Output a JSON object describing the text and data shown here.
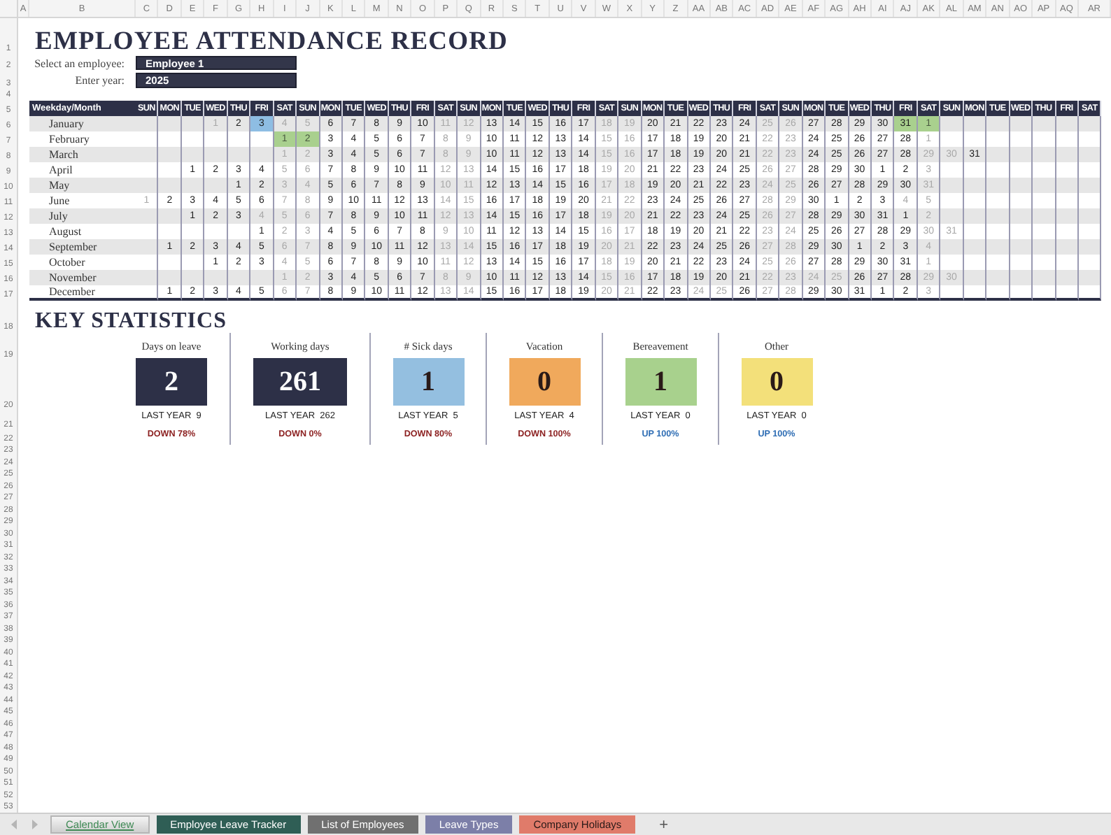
{
  "column_headers": [
    "A",
    "B",
    "C",
    "D",
    "E",
    "F",
    "G",
    "H",
    "I",
    "J",
    "K",
    "L",
    "M",
    "N",
    "O",
    "P",
    "Q",
    "R",
    "S",
    "T",
    "U",
    "V",
    "W",
    "X",
    "Y",
    "Z",
    "AA",
    "AB",
    "AC",
    "AD",
    "AE",
    "AF",
    "AG",
    "AH",
    "AI",
    "AJ",
    "AK",
    "AL",
    "AM",
    "AN",
    "AO",
    "AP",
    "AQ",
    "AR"
  ],
  "row_numbers": [
    "1",
    "2",
    "3",
    "4",
    "5",
    "6",
    "7",
    "8",
    "9",
    "10",
    "11",
    "12",
    "13",
    "14",
    "15",
    "16",
    "17",
    "18",
    "19",
    "20",
    "21",
    "22",
    "23",
    "24",
    "25",
    "26",
    "27",
    "28",
    "29",
    "30",
    "31",
    "32",
    "33",
    "34",
    "35",
    "36",
    "37",
    "38",
    "39",
    "40",
    "41",
    "42",
    "43",
    "44",
    "45",
    "46",
    "47",
    "48",
    "49",
    "50",
    "51",
    "52",
    "53"
  ],
  "title": "EMPLOYEE ATTENDANCE RECORD",
  "fields": [
    {
      "label": "Select an employee:",
      "value": "Employee 1"
    },
    {
      "label": "Enter year:",
      "value": "2025"
    }
  ],
  "calendar": {
    "corner": "Weekday/Month",
    "weekdays": [
      "SUN",
      "MON",
      "TUE",
      "WED",
      "THU",
      "FRI",
      "SAT",
      "SUN",
      "MON",
      "TUE",
      "WED",
      "THU",
      "FRI",
      "SAT",
      "SUN",
      "MON",
      "TUE",
      "WED",
      "THU",
      "FRI",
      "SAT",
      "SUN",
      "MON",
      "TUE",
      "WED",
      "THU",
      "FRI",
      "SAT",
      "SUN",
      "MON",
      "TUE",
      "WED",
      "THU",
      "FRI",
      "SAT",
      "SUN",
      "MON",
      "TUE",
      "WED",
      "THU",
      "FRI",
      "SAT"
    ],
    "rows": [
      {
        "month": "January",
        "days": [
          {
            "blank": true
          },
          {
            "blank": true
          },
          {
            "blank": true
          },
          {
            "day": "1",
            "dim": true
          },
          "2",
          {
            "day": "3",
            "color": "#8ebde3"
          },
          {
            "day": "4",
            "dim": true
          },
          {
            "day": "5",
            "dim": true
          },
          "6",
          "7",
          "8",
          "9",
          "10",
          {
            "day": "11",
            "dim": true
          },
          {
            "day": "12",
            "dim": true
          },
          "13",
          "14",
          "15",
          "16",
          "17",
          {
            "day": "18",
            "dim": true
          },
          {
            "day": "19",
            "dim": true
          },
          "20",
          "21",
          "22",
          "23",
          "24",
          {
            "day": "25",
            "dim": true
          },
          {
            "day": "26",
            "dim": true
          },
          "27",
          "28",
          "29",
          "30",
          {
            "day": "31",
            "color": "#a9d08e"
          },
          {
            "day": "1",
            "dim": true,
            "color": "#a9d08e"
          }
        ]
      },
      {
        "month": "February",
        "days": [
          {
            "blank": true
          },
          {
            "blank": true
          },
          {
            "blank": true
          },
          {
            "blank": true
          },
          {
            "blank": true
          },
          {
            "blank": true
          },
          {
            "day": "1",
            "dim": true,
            "color": "#a9d08e"
          },
          {
            "day": "2",
            "dim": true,
            "color": "#a9d08e"
          },
          "3",
          "4",
          "5",
          "6",
          "7",
          {
            "day": "8",
            "dim": true
          },
          {
            "day": "9",
            "dim": true
          },
          "10",
          "11",
          "12",
          "13",
          "14",
          {
            "day": "15",
            "dim": true
          },
          {
            "day": "16",
            "dim": true
          },
          "17",
          "18",
          "19",
          "20",
          "21",
          {
            "day": "22",
            "dim": true
          },
          {
            "day": "23",
            "dim": true
          },
          "24",
          "25",
          "26",
          "27",
          "28",
          {
            "day": "1",
            "dim": true
          }
        ]
      },
      {
        "month": "March",
        "days": [
          {
            "blank": true
          },
          {
            "blank": true
          },
          {
            "blank": true
          },
          {
            "blank": true
          },
          {
            "blank": true
          },
          {
            "blank": true
          },
          {
            "day": "1",
            "dim": true
          },
          {
            "day": "2",
            "dim": true
          },
          "3",
          "4",
          "5",
          "6",
          "7",
          {
            "day": "8",
            "dim": true
          },
          {
            "day": "9",
            "dim": true
          },
          "10",
          "11",
          "12",
          "13",
          "14",
          {
            "day": "15",
            "dim": true
          },
          {
            "day": "16",
            "dim": true
          },
          "17",
          "18",
          "19",
          "20",
          "21",
          {
            "day": "22",
            "dim": true
          },
          {
            "day": "23",
            "dim": true
          },
          "24",
          "25",
          "26",
          "27",
          "28",
          {
            "day": "29",
            "dim": true
          },
          {
            "day": "30",
            "dim": true
          },
          "31"
        ]
      },
      {
        "month": "April",
        "days": [
          {
            "blank": true
          },
          {
            "blank": true
          },
          "1",
          "2",
          "3",
          "4",
          {
            "day": "5",
            "dim": true
          },
          {
            "day": "6",
            "dim": true
          },
          "7",
          "8",
          "9",
          "10",
          "11",
          {
            "day": "12",
            "dim": true
          },
          {
            "day": "13",
            "dim": true
          },
          "14",
          "15",
          "16",
          "17",
          "18",
          {
            "day": "19",
            "dim": true
          },
          {
            "day": "20",
            "dim": true
          },
          "21",
          "22",
          "23",
          "24",
          "25",
          {
            "day": "26",
            "dim": true
          },
          {
            "day": "27",
            "dim": true
          },
          "28",
          "29",
          "30",
          "1",
          "2",
          {
            "day": "3",
            "dim": true
          }
        ]
      },
      {
        "month": "May",
        "days": [
          {
            "blank": true
          },
          {
            "blank": true
          },
          {
            "blank": true
          },
          {
            "blank": true
          },
          "1",
          "2",
          {
            "day": "3",
            "dim": true
          },
          {
            "day": "4",
            "dim": true
          },
          "5",
          "6",
          "7",
          "8",
          "9",
          {
            "day": "10",
            "dim": true
          },
          {
            "day": "11",
            "dim": true
          },
          "12",
          "13",
          "14",
          "15",
          "16",
          {
            "day": "17",
            "dim": true
          },
          {
            "day": "18",
            "dim": true
          },
          "19",
          "20",
          "21",
          "22",
          "23",
          {
            "day": "24",
            "dim": true
          },
          {
            "day": "25",
            "dim": true
          },
          "26",
          "27",
          "28",
          "29",
          "30",
          {
            "day": "31",
            "dim": true
          }
        ]
      },
      {
        "month": "June",
        "days": [
          {
            "day": "1",
            "dim": true
          },
          "2",
          "3",
          "4",
          "5",
          "6",
          {
            "day": "7",
            "dim": true
          },
          {
            "day": "8",
            "dim": true
          },
          "9",
          "10",
          "11",
          "12",
          "13",
          {
            "day": "14",
            "dim": true
          },
          {
            "day": "15",
            "dim": true
          },
          "16",
          "17",
          "18",
          "19",
          "20",
          {
            "day": "21",
            "dim": true
          },
          {
            "day": "22",
            "dim": true
          },
          "23",
          "24",
          "25",
          "26",
          "27",
          {
            "day": "28",
            "dim": true
          },
          {
            "day": "29",
            "dim": true
          },
          "30",
          "1",
          "2",
          "3",
          {
            "day": "4",
            "dim": true
          },
          {
            "day": "5",
            "dim": true
          }
        ]
      },
      {
        "month": "July",
        "days": [
          {
            "blank": true
          },
          {
            "blank": true
          },
          "1",
          "2",
          "3",
          {
            "day": "4",
            "dim": true
          },
          {
            "day": "5",
            "dim": true
          },
          {
            "day": "6",
            "dim": true
          },
          "7",
          "8",
          "9",
          "10",
          "11",
          {
            "day": "12",
            "dim": true
          },
          {
            "day": "13",
            "dim": true
          },
          "14",
          "15",
          "16",
          "17",
          "18",
          {
            "day": "19",
            "dim": true
          },
          {
            "day": "20",
            "dim": true
          },
          "21",
          "22",
          "23",
          "24",
          "25",
          {
            "day": "26",
            "dim": true
          },
          {
            "day": "27",
            "dim": true
          },
          "28",
          "29",
          "30",
          "31",
          "1",
          {
            "day": "2",
            "dim": true
          }
        ]
      },
      {
        "month": "August",
        "days": [
          {
            "blank": true
          },
          {
            "blank": true
          },
          {
            "blank": true
          },
          {
            "blank": true
          },
          {
            "blank": true
          },
          "1",
          {
            "day": "2",
            "dim": true
          },
          {
            "day": "3",
            "dim": true
          },
          "4",
          "5",
          "6",
          "7",
          "8",
          {
            "day": "9",
            "dim": true
          },
          {
            "day": "10",
            "dim": true
          },
          "11",
          "12",
          "13",
          "14",
          "15",
          {
            "day": "16",
            "dim": true
          },
          {
            "day": "17",
            "dim": true
          },
          "18",
          "19",
          "20",
          "21",
          "22",
          {
            "day": "23",
            "dim": true
          },
          {
            "day": "24",
            "dim": true
          },
          "25",
          "26",
          "27",
          "28",
          "29",
          {
            "day": "30",
            "dim": true
          },
          {
            "day": "31",
            "dim": true
          }
        ]
      },
      {
        "month": "September",
        "days": [
          {
            "blank": true
          },
          "1",
          "2",
          "3",
          "4",
          "5",
          {
            "day": "6",
            "dim": true
          },
          {
            "day": "7",
            "dim": true
          },
          "8",
          "9",
          "10",
          "11",
          "12",
          {
            "day": "13",
            "dim": true
          },
          {
            "day": "14",
            "dim": true
          },
          "15",
          "16",
          "17",
          "18",
          "19",
          {
            "day": "20",
            "dim": true
          },
          {
            "day": "21",
            "dim": true
          },
          "22",
          "23",
          "24",
          "25",
          "26",
          {
            "day": "27",
            "dim": true
          },
          {
            "day": "28",
            "dim": true
          },
          "29",
          "30",
          "1",
          "2",
          "3",
          {
            "day": "4",
            "dim": true
          }
        ]
      },
      {
        "month": "October",
        "days": [
          {
            "blank": true
          },
          {
            "blank": true
          },
          {
            "blank": true
          },
          "1",
          "2",
          "3",
          {
            "day": "4",
            "dim": true
          },
          {
            "day": "5",
            "dim": true
          },
          "6",
          "7",
          "8",
          "9",
          "10",
          {
            "day": "11",
            "dim": true
          },
          {
            "day": "12",
            "dim": true
          },
          "13",
          "14",
          "15",
          "16",
          "17",
          {
            "day": "18",
            "dim": true
          },
          {
            "day": "19",
            "dim": true
          },
          "20",
          "21",
          "22",
          "23",
          "24",
          {
            "day": "25",
            "dim": true
          },
          {
            "day": "26",
            "dim": true
          },
          "27",
          "28",
          "29",
          "30",
          "31",
          {
            "day": "1",
            "dim": true
          }
        ]
      },
      {
        "month": "November",
        "days": [
          {
            "blank": true
          },
          {
            "blank": true
          },
          {
            "blank": true
          },
          {
            "blank": true
          },
          {
            "blank": true
          },
          {
            "blank": true
          },
          {
            "day": "1",
            "dim": true
          },
          {
            "day": "2",
            "dim": true
          },
          "3",
          "4",
          "5",
          "6",
          "7",
          {
            "day": "8",
            "dim": true
          },
          {
            "day": "9",
            "dim": true
          },
          "10",
          "11",
          "12",
          "13",
          "14",
          {
            "day": "15",
            "dim": true
          },
          {
            "day": "16",
            "dim": true
          },
          "17",
          "18",
          "19",
          "20",
          "21",
          {
            "day": "22",
            "dim": true
          },
          {
            "day": "23",
            "dim": true
          },
          {
            "day": "24",
            "dim": true
          },
          {
            "day": "25",
            "dim": true
          },
          "26",
          "27",
          "28",
          {
            "day": "29",
            "dim": true
          },
          {
            "day": "30",
            "dim": true
          }
        ]
      },
      {
        "month": "December",
        "days": [
          {
            "blank": true
          },
          "1",
          "2",
          "3",
          "4",
          "5",
          {
            "day": "6",
            "dim": true
          },
          {
            "day": "7",
            "dim": true
          },
          "8",
          "9",
          "10",
          "11",
          "12",
          {
            "day": "13",
            "dim": true
          },
          {
            "day": "14",
            "dim": true
          },
          "15",
          "16",
          "17",
          "18",
          "19",
          {
            "day": "20",
            "dim": true
          },
          {
            "day": "21",
            "dim": true
          },
          "22",
          "23",
          {
            "day": "24",
            "dim": true
          },
          {
            "day": "25",
            "dim": true
          },
          "26",
          {
            "day": "27",
            "dim": true
          },
          {
            "day": "28",
            "dim": true
          },
          "29",
          "30",
          "31",
          "1",
          "2",
          {
            "day": "3",
            "dim": true
          }
        ]
      }
    ]
  },
  "statistics": {
    "title": "KEY STATISTICS",
    "items": [
      {
        "label": "Days on leave",
        "value": "2",
        "color": "#2d3047",
        "last_year": "LAST YEAR  9",
        "change": {
          "text": "DOWN 78%",
          "color": "#8b1f1f"
        }
      },
      {
        "label": "Working days",
        "value": "261",
        "color": "#2d3047",
        "last_year": "LAST YEAR  262",
        "change": {
          "text": "DOWN 0%",
          "color": "#8b1f1f"
        }
      },
      {
        "label": "# Sick days",
        "value": "1",
        "color": "#94bfe0",
        "last_year": "LAST YEAR  5",
        "change": {
          "text": "DOWN 80%",
          "color": "#8b1f1f"
        }
      },
      {
        "label": "Vacation",
        "value": "0",
        "color": "#f0a95c",
        "last_year": "LAST YEAR  4",
        "change": {
          "text": "DOWN 100%",
          "color": "#8b1f1f"
        }
      },
      {
        "label": "Bereavement",
        "value": "1",
        "color": "#a8d18d",
        "last_year": "LAST YEAR  0",
        "change": {
          "text": "UP 100%",
          "color": "#2e6db4"
        }
      },
      {
        "label": "Other",
        "value": "0",
        "color": "#f3e07a",
        "last_year": "LAST YEAR  0",
        "change": {
          "text": "UP 100%",
          "color": "#2e6db4"
        }
      }
    ]
  },
  "sheet_tabs": [
    {
      "label": "Calendar View",
      "color": "#3f8a55",
      "selected": true
    },
    {
      "label": "Employee Leave Tracker",
      "color": "#2f5e55",
      "selected": false
    },
    {
      "label": "List of Employees",
      "color": "#707070",
      "selected": false
    },
    {
      "label": "Leave Types",
      "color": "#7c7fa8",
      "selected": false
    },
    {
      "label": "Company Holidays",
      "color": "#e07b6a",
      "selected": false
    }
  ],
  "add_sheet": "+"
}
